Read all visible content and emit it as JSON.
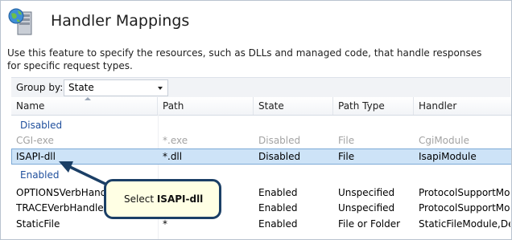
{
  "page": {
    "title": "Handler Mappings",
    "description": "Use this feature to specify the resources, such as DLLs and managed code, that handle responses for specific request types."
  },
  "groupby": {
    "label": "Group by:",
    "value": "State"
  },
  "columns": [
    "Name",
    "Path",
    "State",
    "Path Type",
    "Handler"
  ],
  "groups": {
    "disabled": "Disabled",
    "enabled": "Enabled"
  },
  "rows": [
    {
      "name": "CGI-exe",
      "path": "*.exe",
      "state": "Disabled",
      "path_type": "File",
      "handler": "CgiModule"
    },
    {
      "name": "ISAPI-dll",
      "path": "*.dll",
      "state": "Disabled",
      "path_type": "File",
      "handler": "IsapiModule"
    },
    {
      "name": "OPTIONSVerbHandler",
      "path": "*",
      "state": "Enabled",
      "path_type": "Unspecified",
      "handler": "ProtocolSupportModule"
    },
    {
      "name": "TRACEVerbHandler",
      "path": "*",
      "state": "Enabled",
      "path_type": "Unspecified",
      "handler": "ProtocolSupportModule"
    },
    {
      "name": "StaticFile",
      "path": "*",
      "state": "Enabled",
      "path_type": "File or Folder",
      "handler": "StaticFileModule,DefaultDocumentModule"
    }
  ],
  "callout": {
    "prefix": "Select ",
    "target": "ISAPI-dll"
  },
  "colors": {
    "accent": "#1f4f9c",
    "selection": "#cde3f7",
    "callout_fill": "#ffffe4",
    "callout_border": "#1b3f66"
  }
}
